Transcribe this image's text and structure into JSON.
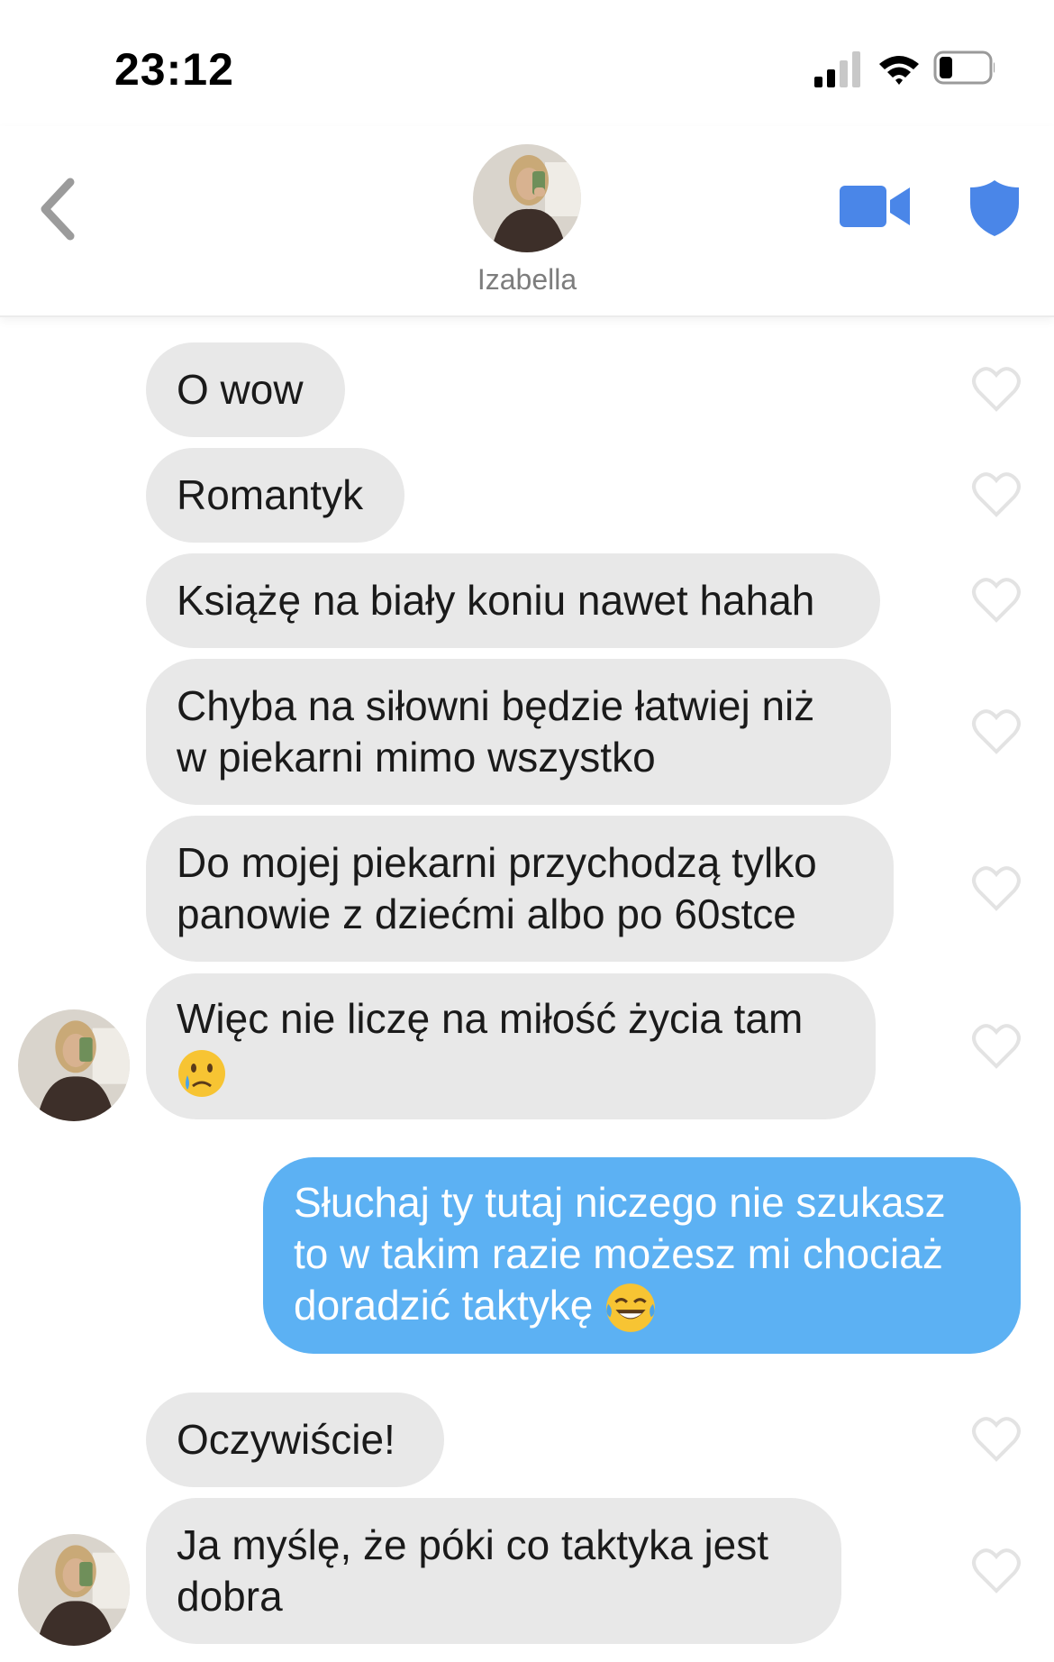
{
  "status_bar": {
    "time": "23:12",
    "icons": [
      "cellular-signal-icon",
      "wifi-icon",
      "battery-icon"
    ]
  },
  "header": {
    "back_icon": "chevron-left-icon",
    "contact_name": "Izabella",
    "video_call_icon": "video-camera-icon",
    "safety_icon": "shield-icon"
  },
  "colors": {
    "accent": "#4a86e8",
    "incoming_bubble": "#e8e8e8",
    "outgoing_bubble": "#5cb1f3",
    "heart_outline": "#e3e3e3"
  },
  "messages": [
    {
      "direction": "in",
      "text": "O wow"
    },
    {
      "direction": "in",
      "text": "Romantyk"
    },
    {
      "direction": "in",
      "text": "Książę na biały koniu nawet hahah"
    },
    {
      "direction": "in",
      "text": "Chyba na siłowni będzie łatwiej niż\nw piekarni mimo wszystko"
    },
    {
      "direction": "in",
      "text": "Do mojej piekarni przychodzą tylko\npanowie z dziećmi albo po 60stce"
    },
    {
      "direction": "in",
      "text": "Więc nie liczę na miłość życia tam",
      "emoji": "crying-face-emoji"
    },
    {
      "direction": "out",
      "text": "Słuchaj ty tutaj niczego nie szukasz\nto w takim razie możesz mi chociaż\ndoradzić taktykę",
      "emoji": "tears-of-joy-emoji"
    },
    {
      "direction": "in",
      "text": "Oczywiście!"
    },
    {
      "direction": "in",
      "text": "Ja myślę, że póki co taktyka jest\ndobra"
    }
  ]
}
